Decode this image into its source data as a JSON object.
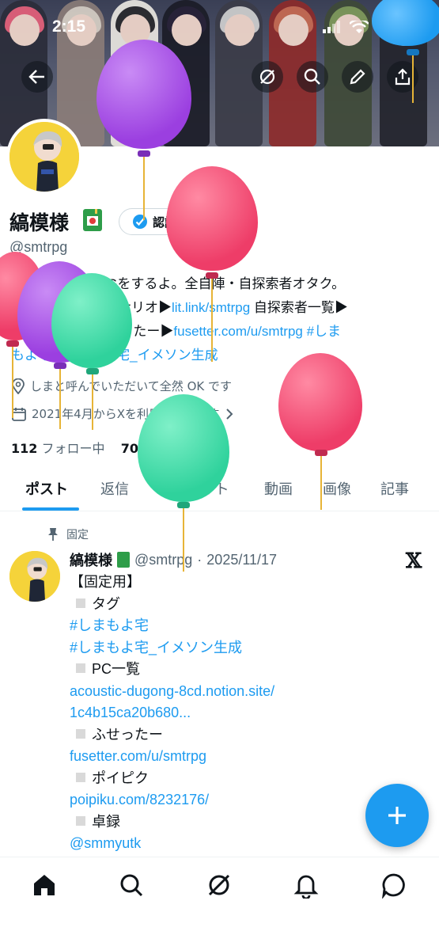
{
  "status_bar": {
    "time": "2:15"
  },
  "profile": {
    "name": "縞模様",
    "verify_label": "認証を受ける",
    "handle": "@smtrpg",
    "bio_text_1": "@",
    "bio_text_2": "TRPGをするよ。全自陣・自探索者オタク。",
    "bio_text_3": "通過済",
    "bio_text_4": "回せるシナリオ▶",
    "bio_link_1": "lit.link/smtrpg",
    "bio_text_5": " 自探索者一覧▶",
    "bio_link_2": "x.gd/y",
    "bio_link_3": "DY",
    "bio_text_6": " ふせったー▶",
    "bio_link_4": "fusetter.com/u/smtrpg",
    "bio_link_5": " #しま",
    "bio_link_6": "もよ宅",
    "bio_link_7": " #しまもよ宅_イメソン生成",
    "location": "しまと呼んでいただいて全然 OK です",
    "joined": "2021年4月からXを利用しています",
    "following_count": "112",
    "following_label": "フォロー中",
    "followers_count": "70",
    "followers_label": "フォロワー"
  },
  "tabs": [
    {
      "label": "ポスト"
    },
    {
      "label": "返信"
    },
    {
      "label": "ハイライト"
    },
    {
      "label": "動画"
    },
    {
      "label": "画像"
    },
    {
      "label": "記事"
    }
  ],
  "post": {
    "pinned_label": "固定",
    "name": "縞模様",
    "handle": "@smtrpg",
    "separator": "·",
    "date": "2025/11/17",
    "line_1": "【固定用】",
    "line_2": "タグ",
    "line_3": "#しまもよ宅",
    "line_4": "#しまもよ宅_イメソン生成",
    "line_5": "PC一覧",
    "line_6": "acoustic-dugong-8cd.notion.site/",
    "line_7": "1c4b15ca20b680...",
    "line_8": "ふせったー",
    "line_9": "fusetter.com/u/smtrpg",
    "line_10": "ポイピク",
    "line_11": "poipiku.com/8232176/",
    "line_12": "卓録",
    "line_13": "@smmyutk"
  },
  "fab": {
    "icon": "plus"
  },
  "nav": {
    "items": [
      "home-icon",
      "search-icon",
      "grok-icon",
      "bell-icon",
      "message-icon"
    ]
  },
  "colors": {
    "accent": "#1d9bf0",
    "balloon_purple": "#a855e6",
    "balloon_pink": "#f0436a",
    "balloon_green": "#36d6a2"
  }
}
